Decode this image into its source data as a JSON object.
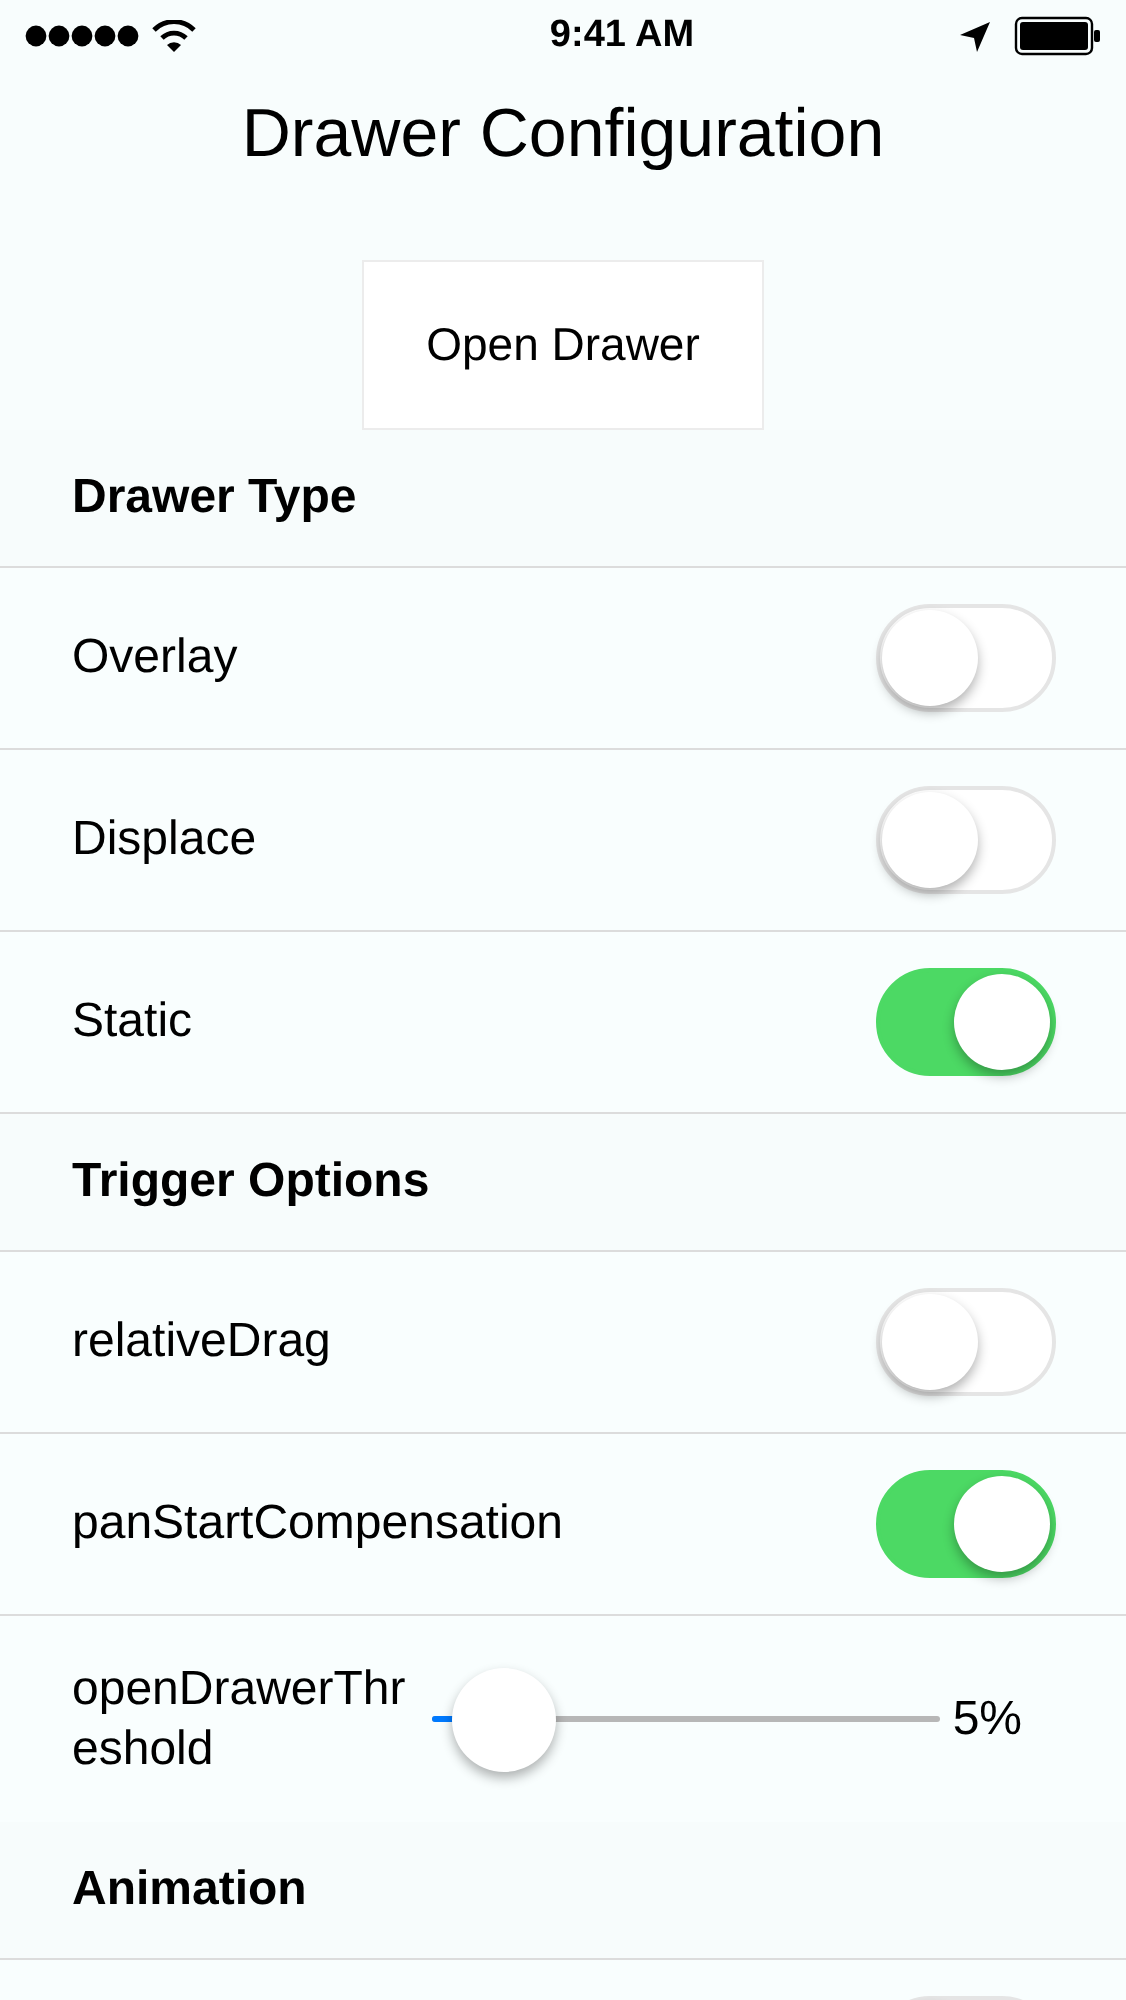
{
  "status_bar": {
    "time": "9:41 AM"
  },
  "title": "Drawer Configuration",
  "open_button": "Open Drawer",
  "sections": [
    {
      "header": "Drawer Type",
      "rows": [
        {
          "kind": "switch",
          "label": "Overlay",
          "on": false
        },
        {
          "kind": "switch",
          "label": "Displace",
          "on": false
        },
        {
          "kind": "switch",
          "label": "Static",
          "on": true
        }
      ]
    },
    {
      "header": "Trigger Options",
      "rows": [
        {
          "kind": "switch",
          "label": "relativeDrag",
          "on": false
        },
        {
          "kind": "switch",
          "label": "panStartCompensation",
          "on": true
        },
        {
          "kind": "slider",
          "label": "openDrawerThreshold",
          "level": 0.05,
          "reading": "5%"
        }
      ]
    },
    {
      "header": "Animation",
      "rows": [
        {
          "kind": "switch",
          "on": false
        }
      ]
    }
  ]
}
